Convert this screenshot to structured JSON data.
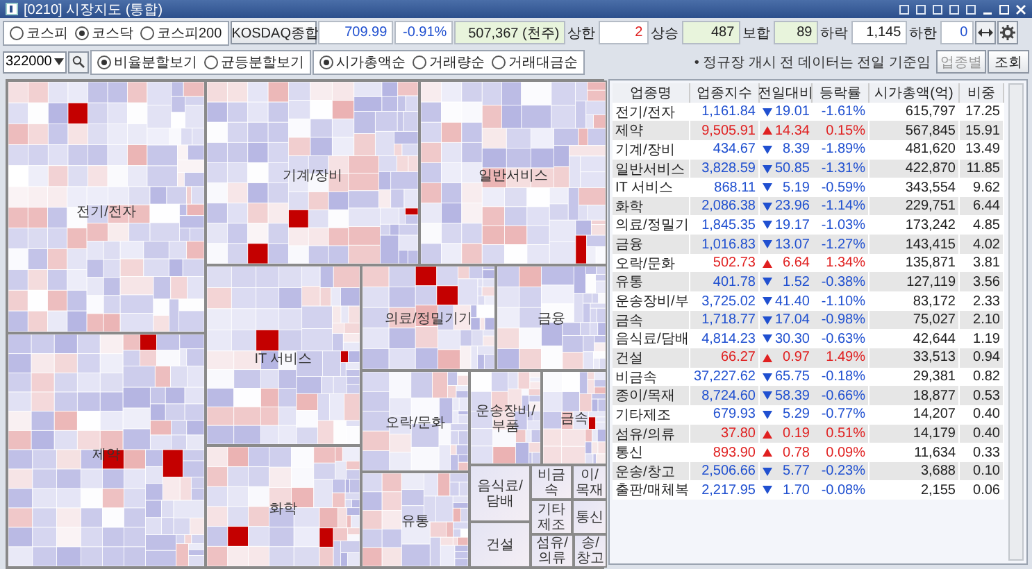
{
  "window": {
    "title": "[0210] 시장지도 (통합)"
  },
  "market_tabs": [
    {
      "label": "코스피",
      "selected": false
    },
    {
      "label": "코스닥",
      "selected": true
    },
    {
      "label": "코스피200",
      "selected": false
    }
  ],
  "index_button": "KOSDAQ종합",
  "index_value": "709.99",
  "index_rate": "-0.91%",
  "volume": "507,367 (천주)",
  "stats": [
    {
      "label": "상한",
      "value": "2",
      "color": "#e02020",
      "highlight": false
    },
    {
      "label": "상승",
      "value": "487",
      "color": "#222222",
      "highlight": true
    },
    {
      "label": "보합",
      "value": "89",
      "color": "#222222",
      "highlight": true
    },
    {
      "label": "하락",
      "value": "1,145",
      "color": "#222222",
      "highlight": false
    },
    {
      "label": "하한",
      "value": "0",
      "color": "#2050d0",
      "highlight": false
    }
  ],
  "code_field": {
    "value": "322000"
  },
  "view_modes": [
    {
      "label": "비율분할보기",
      "selected": true
    },
    {
      "label": "균등분할보기",
      "selected": false
    }
  ],
  "sort_modes": [
    {
      "label": "시가총액순",
      "selected": true
    },
    {
      "label": "거래량순",
      "selected": false
    },
    {
      "label": "거래대금순",
      "selected": false
    }
  ],
  "note": "• 정규장 개시 전 데이터는 전일 기준임",
  "sector_button": {
    "label": "업종별",
    "disabled": true
  },
  "query_button": "조회",
  "treemap": {
    "sectors": [
      {
        "label": "전기/전자"
      },
      {
        "label": "기계/장비"
      },
      {
        "label": "일반서비스"
      },
      {
        "label": "제약"
      },
      {
        "label": "IT 서비스"
      },
      {
        "label": "의료/정밀기기"
      },
      {
        "label": "금융"
      },
      {
        "label": "화학"
      },
      {
        "label": "오락/문화"
      },
      {
        "label": "운송장비/부품"
      },
      {
        "label": "금속"
      },
      {
        "label": "유통"
      },
      {
        "label": "음식료/담배"
      },
      {
        "label": "비금속"
      },
      {
        "label": "이/목재"
      },
      {
        "label": "기타제조"
      },
      {
        "label": "통신"
      },
      {
        "label": "건설"
      },
      {
        "label": "섬유/의류"
      },
      {
        "label": "송/창고"
      }
    ]
  },
  "table": {
    "columns": [
      "업종명",
      "업종지수",
      "전일대비",
      "등락률",
      "시가총액(억)",
      "비중"
    ],
    "rows": [
      {
        "name": "전기/전자",
        "index": "1,161.84",
        "rising": false,
        "change": "19.01",
        "rate": "-1.61%",
        "cap": "615,797",
        "weight": "17.25"
      },
      {
        "name": "제약",
        "index": "9,505.91",
        "rising": true,
        "change": "14.34",
        "rate": "0.15%",
        "cap": "567,845",
        "weight": "15.91"
      },
      {
        "name": "기계/장비",
        "index": "434.67",
        "rising": false,
        "change": "8.39",
        "rate": "-1.89%",
        "cap": "481,620",
        "weight": "13.49"
      },
      {
        "name": "일반서비스",
        "index": "3,828.59",
        "rising": false,
        "change": "50.85",
        "rate": "-1.31%",
        "cap": "422,870",
        "weight": "11.85"
      },
      {
        "name": "IT 서비스",
        "index": "868.11",
        "rising": false,
        "change": "5.19",
        "rate": "-0.59%",
        "cap": "343,554",
        "weight": "9.62"
      },
      {
        "name": "화학",
        "index": "2,086.38",
        "rising": false,
        "change": "23.96",
        "rate": "-1.14%",
        "cap": "229,751",
        "weight": "6.44"
      },
      {
        "name": "의료/정밀기",
        "index": "1,845.35",
        "rising": false,
        "change": "19.17",
        "rate": "-1.03%",
        "cap": "173,242",
        "weight": "4.85"
      },
      {
        "name": "금융",
        "index": "1,016.83",
        "rising": false,
        "change": "13.07",
        "rate": "-1.27%",
        "cap": "143,415",
        "weight": "4.02"
      },
      {
        "name": "오락/문화",
        "index": "502.73",
        "rising": true,
        "change": "6.64",
        "rate": "1.34%",
        "cap": "135,871",
        "weight": "3.81"
      },
      {
        "name": "유통",
        "index": "401.78",
        "rising": false,
        "change": "1.52",
        "rate": "-0.38%",
        "cap": "127,119",
        "weight": "3.56"
      },
      {
        "name": "운송장비/부",
        "index": "3,725.02",
        "rising": false,
        "change": "41.40",
        "rate": "-1.10%",
        "cap": "83,172",
        "weight": "2.33"
      },
      {
        "name": "금속",
        "index": "1,718.77",
        "rising": false,
        "change": "17.04",
        "rate": "-0.98%",
        "cap": "75,027",
        "weight": "2.10"
      },
      {
        "name": "음식료/담배",
        "index": "4,814.23",
        "rising": false,
        "change": "30.30",
        "rate": "-0.63%",
        "cap": "42,644",
        "weight": "1.19"
      },
      {
        "name": "건설",
        "index": "66.27",
        "rising": true,
        "change": "0.97",
        "rate": "1.49%",
        "cap": "33,513",
        "weight": "0.94"
      },
      {
        "name": "비금속",
        "index": "37,227.62",
        "rising": false,
        "change": "65.75",
        "rate": "-0.18%",
        "cap": "29,381",
        "weight": "0.82"
      },
      {
        "name": "종이/목재",
        "index": "8,724.60",
        "rising": false,
        "change": "58.39",
        "rate": "-0.66%",
        "cap": "18,877",
        "weight": "0.53"
      },
      {
        "name": "기타제조",
        "index": "679.93",
        "rising": false,
        "change": "5.29",
        "rate": "-0.77%",
        "cap": "14,207",
        "weight": "0.40"
      },
      {
        "name": "섬유/의류",
        "index": "37.80",
        "rising": true,
        "change": "0.19",
        "rate": "0.51%",
        "cap": "14,179",
        "weight": "0.40"
      },
      {
        "name": "통신",
        "index": "893.90",
        "rising": true,
        "change": "0.78",
        "rate": "0.09%",
        "cap": "11,634",
        "weight": "0.33"
      },
      {
        "name": "운송/창고",
        "index": "2,506.66",
        "rising": false,
        "change": "5.77",
        "rate": "-0.23%",
        "cap": "3,688",
        "weight": "0.10"
      },
      {
        "name": "출판/매체복",
        "index": "2,217.95",
        "rising": false,
        "change": "1.70",
        "rate": "-0.08%",
        "cap": "2,155",
        "weight": "0.06"
      }
    ]
  }
}
